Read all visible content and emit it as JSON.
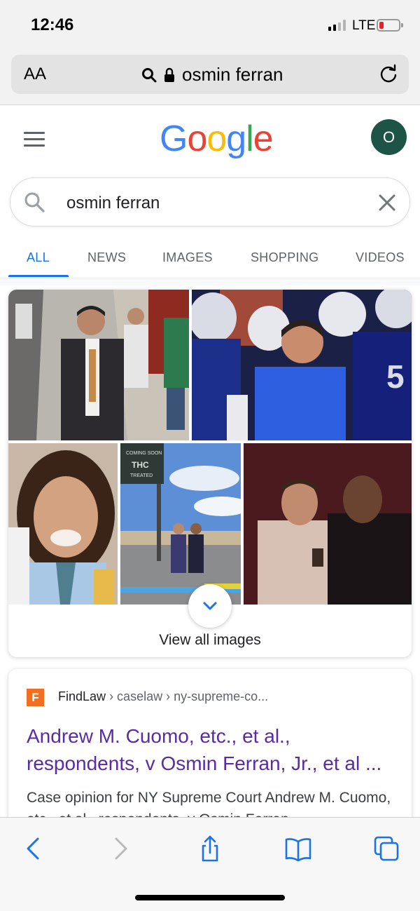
{
  "status_bar": {
    "time": "12:46",
    "network": "LTE"
  },
  "address_bar": {
    "text_size_label": "AA",
    "url": "osmin ferran",
    "icons": [
      "search-icon",
      "lock-icon",
      "reload-icon"
    ]
  },
  "google": {
    "logo": [
      "G",
      "o",
      "o",
      "g",
      "l",
      "e"
    ],
    "logo_colors": [
      "#4285f4",
      "#ea4335",
      "#fbbc05",
      "#4285f4",
      "#34a853",
      "#ea4335"
    ],
    "avatar_letter": "O",
    "avatar_color": "#1e5445"
  },
  "search": {
    "value": "osmin ferran"
  },
  "tabs": [
    {
      "label": "ALL",
      "active": true
    },
    {
      "label": "NEWS"
    },
    {
      "label": "IMAGES"
    },
    {
      "label": "SHOPPING"
    },
    {
      "label": "VIDEOS"
    }
  ],
  "images_card": {
    "thumbnails": [
      "man-in-suit-on-street",
      "man-with-football-players",
      "smiling-man-portrait",
      "two-men-by-sign",
      "two-men-indoors"
    ],
    "sign_text": [
      "COMING SOON",
      "THC",
      "TREATED"
    ],
    "view_all_label": "View all images"
  },
  "result": {
    "favicon_letter": "F",
    "site_name": "FindLaw",
    "breadcrumb": "› caselaw › ny-supreme-co...",
    "title": "Andrew M. Cuomo, etc., et al., respondents, v Osmin Ferran, Jr., et al ...",
    "snippet": "Case opinion for NY Supreme Court Andrew M. Cuomo, etc., et al., respondents, v Osmin Ferran"
  },
  "colors": {
    "accent": "#1a73e8",
    "visited_link": "#5a2aa8",
    "findlaw_orange": "#f26f21"
  },
  "toolbar": {
    "icons": [
      "back-icon",
      "forward-icon",
      "share-icon",
      "bookmarks-icon",
      "tabs-icon"
    ]
  }
}
